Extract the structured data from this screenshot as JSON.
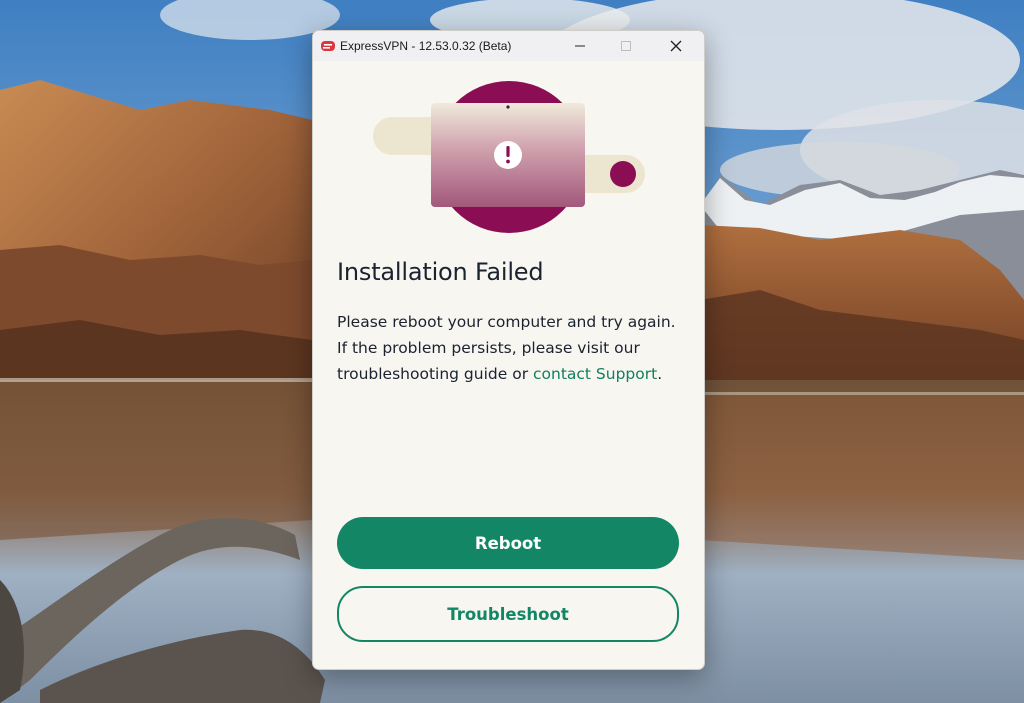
{
  "window": {
    "app_name": "ExpressVPN",
    "title_suffix": " - 12.53.0.32 (Beta)",
    "controls": [
      "minimize",
      "maximize",
      "close"
    ]
  },
  "dialog": {
    "illustration": "laptop-warning-illustration",
    "title": "Installation Failed",
    "message_text": "Please reboot your computer and try again. If the problem persists, please visit our troubleshooting guide or ",
    "support_link": "contact Support",
    "message_end": "."
  },
  "buttons": {
    "reboot": "Reboot",
    "troubleshoot": "Troubleshoot"
  },
  "colors": {
    "accent": "#138666",
    "brand_red": "#da3940",
    "illustration_purple": "#8b0e55",
    "background": "#f8f6f1"
  }
}
